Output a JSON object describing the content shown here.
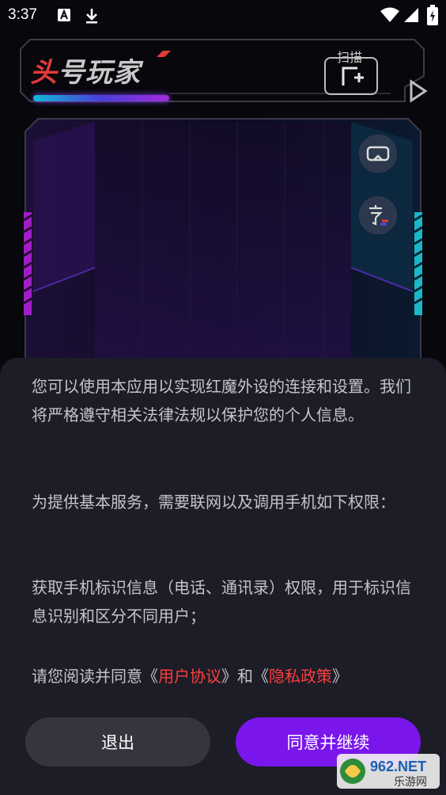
{
  "status_bar": {
    "time": "3:37",
    "icons": [
      "a-notification-icon",
      "download-icon",
      "wifi-icon",
      "signal-icon",
      "battery-icon"
    ]
  },
  "header": {
    "logo_first": "头",
    "logo_rest": "号玩家",
    "scan_label": "扫描"
  },
  "panel": {
    "buttons": [
      "vr-headset-icon",
      "subtitle-icon"
    ]
  },
  "dialog": {
    "para1": "您可以使用本应用以实现红魔外设的连接和设置。我们将严格遵守相关法律法规以保护您的个人信息。",
    "para2": "为提供基本服务，需要联网以及调用手机如下权限：",
    "para3": "获取手机标识信息（电话、通讯录）权限，用于标识信息识别和区分不同用户；",
    "consent": {
      "prefix": "请您阅读并同意《",
      "user_agreement": "用户协议",
      "middle": "》和《",
      "privacy_policy": "隐私政策",
      "suffix": "》"
    }
  },
  "buttons": {
    "exit": "退出",
    "agree": "同意并继续"
  },
  "watermark": {
    "brand": "962.NET",
    "sub": "乐游网"
  },
  "colors": {
    "accent_purple": "#7a16ec",
    "link_red": "#ff3d3d",
    "dialog_bg": "#1c1d27",
    "glow_cyan": "#0fb9d8",
    "glow_magenta": "#a42adb"
  }
}
